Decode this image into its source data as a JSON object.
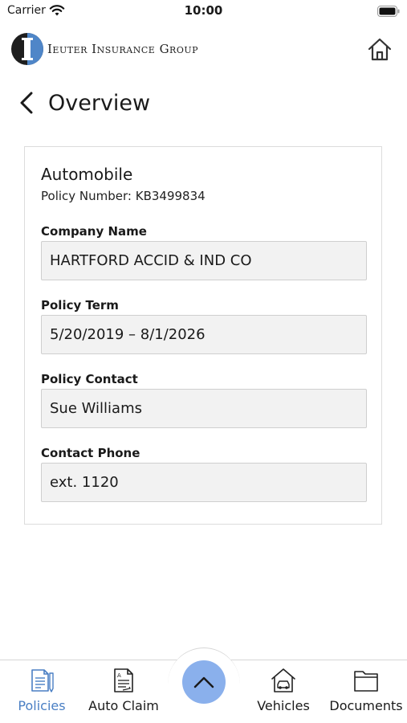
{
  "status_bar": {
    "carrier": "Carrier",
    "time": "10:00"
  },
  "header": {
    "logo_text": "Ieuter Insurance Group",
    "logo_letter": "I"
  },
  "page": {
    "title": "Overview"
  },
  "policy": {
    "type": "Automobile",
    "policy_number": "Policy Number: KB3499834",
    "fields": [
      {
        "label": "Company Name",
        "value": "HARTFORD ACCID & IND CO"
      },
      {
        "label": "Policy Term",
        "value": "5/20/2019 – 8/1/2026"
      },
      {
        "label": "Policy Contact",
        "value": "Sue Williams"
      },
      {
        "label": "Contact Phone",
        "value": "ext. 1120"
      }
    ]
  },
  "tab_bar": {
    "tabs": [
      {
        "label": "Policies",
        "icon": "policies-icon",
        "active": true
      },
      {
        "label": "Auto Claim",
        "icon": "auto-claim-icon",
        "active": false
      },
      {
        "label": "Vehicles",
        "icon": "vehicles-icon",
        "active": false
      },
      {
        "label": "Documents",
        "icon": "documents-icon",
        "active": false
      }
    ],
    "center_button_icon": "chevron-up-icon"
  },
  "colors": {
    "accent": "#4a7fc4",
    "center_button": "#8ab0ec",
    "field_bg": "#f2f2f2"
  }
}
